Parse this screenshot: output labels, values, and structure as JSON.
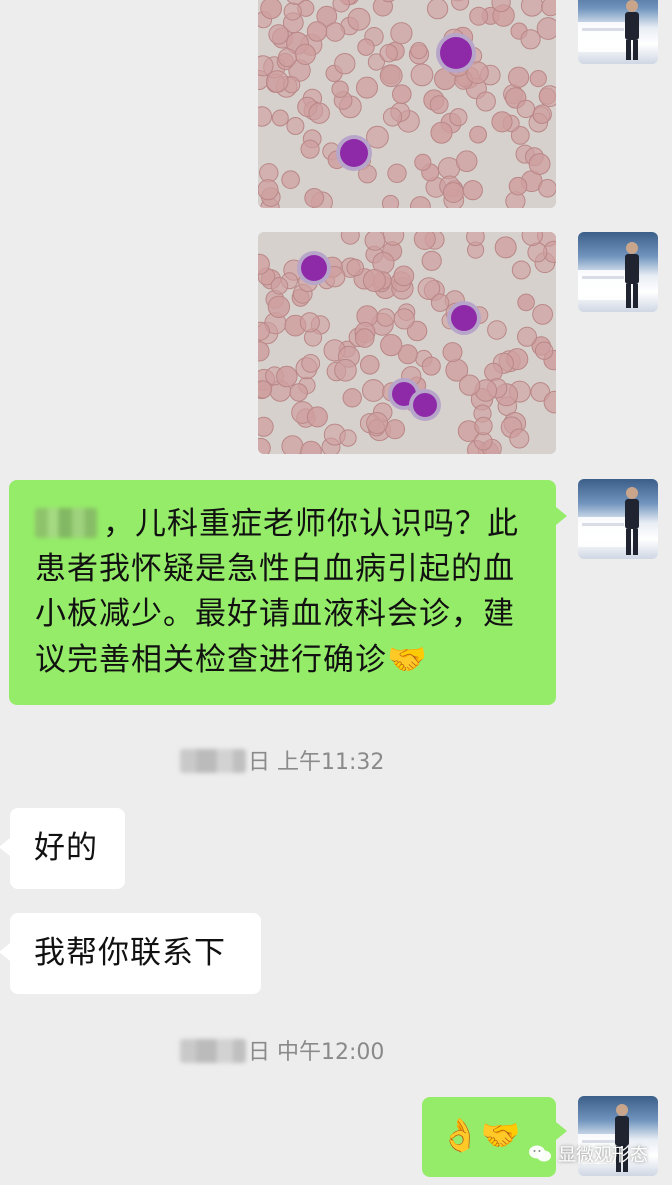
{
  "messages": {
    "msg3": {
      "text": "，儿科重症老师你认识吗？此患者我怀疑是急性白血病引起的血小板减少。最好请血液科会诊，建议完善相关检查进行确诊",
      "emoji": "🤝"
    },
    "time1": {
      "suffix": "日 上午11:32"
    },
    "msg4": {
      "text": "好的"
    },
    "msg5": {
      "text": "我帮你联系下"
    },
    "time2": {
      "suffix": "日 中午12:00"
    },
    "msg6": {
      "emoji1": "👌",
      "emoji2": "🤝"
    }
  },
  "watermark": {
    "text": "显微观形态",
    "icon": "wechat-icon"
  },
  "colors": {
    "background": "#ededed",
    "sent_bubble": "#95ec69",
    "received_bubble": "#ffffff",
    "time_text": "#8a8a8a",
    "blast_cell": "#8e2aa8",
    "rbc": "#cf9f9f"
  }
}
